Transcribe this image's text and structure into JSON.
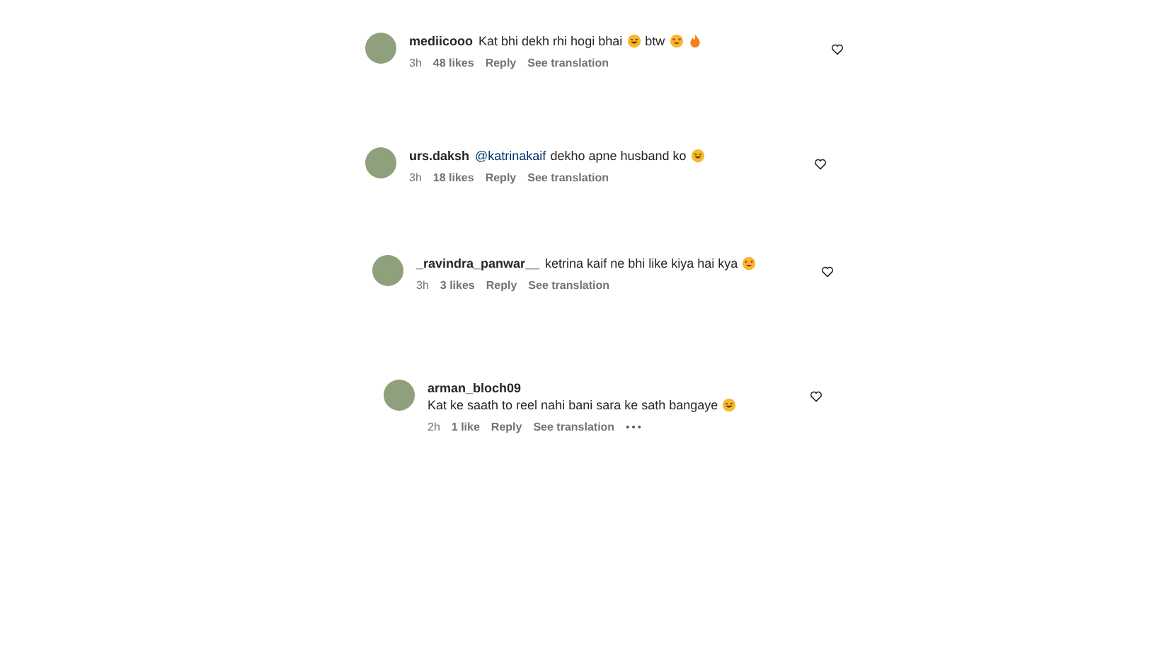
{
  "comments": [
    {
      "username": "mediicooo",
      "content": [
        {
          "kind": "text",
          "text": "Kat bhi dekh rhi hogi bhai"
        },
        {
          "kind": "laugh"
        },
        {
          "kind": "text",
          "text": "btw"
        },
        {
          "kind": "heart-eyes"
        },
        {
          "kind": "fire"
        }
      ],
      "time": "3h",
      "likes": "48 likes",
      "reply": "Reply",
      "translate": "See translation",
      "more": false
    },
    {
      "username": "urs.daksh",
      "content": [
        {
          "kind": "mention",
          "text": "@katrinakaif"
        },
        {
          "kind": "text",
          "text": "dekho apne husband ko"
        },
        {
          "kind": "laugh"
        }
      ],
      "time": "3h",
      "likes": "18 likes",
      "reply": "Reply",
      "translate": "See translation",
      "more": false
    },
    {
      "username": "_ravindra_panwar__",
      "content": [
        {
          "kind": "text",
          "text": "ketrina kaif ne bhi like kiya hai kya"
        },
        {
          "kind": "heart-eyes"
        }
      ],
      "time": "3h",
      "likes": "3 likes",
      "reply": "Reply",
      "translate": "See translation",
      "more": false
    },
    {
      "username": "arman_bloch09",
      "content": [
        {
          "kind": "text",
          "text": "Kat ke saath to reel nahi bani sara ke sath bangaye"
        },
        {
          "kind": "laugh"
        }
      ],
      "time": "2h",
      "likes": "1 like",
      "reply": "Reply",
      "translate": "See translation",
      "more": true
    }
  ]
}
